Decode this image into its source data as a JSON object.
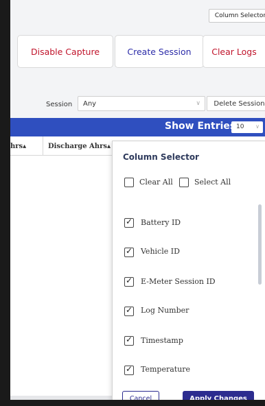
{
  "top": {
    "column_selector_label": "Column Selector"
  },
  "actions": {
    "disable_capture": "Disable Capture",
    "create_session": "Create Session",
    "clear_logs": "Clear Logs"
  },
  "session": {
    "label": "Session",
    "selected": "Any",
    "delete_label": "Delete Session"
  },
  "entries": {
    "label": "Show Entries:",
    "selected": "10"
  },
  "table": {
    "headers": [
      "hrs▴",
      "Discharge Ahrs▴"
    ]
  },
  "column_panel": {
    "title": "Column Selector",
    "clear_all": "Clear All",
    "select_all": "Select All",
    "columns": [
      {
        "label": "Battery ID",
        "checked": true
      },
      {
        "label": "Vehicle ID",
        "checked": true
      },
      {
        "label": "E-Meter Session ID",
        "checked": true
      },
      {
        "label": "Log Number",
        "checked": true
      },
      {
        "label": "Timestamp",
        "checked": true
      },
      {
        "label": "Temperature",
        "checked": true
      }
    ],
    "cancel_label": "Cancel",
    "apply_label": "Apply Changes"
  },
  "colors": {
    "accent_blue": "#2f4fbf",
    "danger_red": "#c0132a",
    "primary_button": "#2c2c8f"
  },
  "icons": {
    "session_dropdown": "chevron-down-icon",
    "entries_dropdown": "chevron-down-icon",
    "checkbox_checked": "checkmark-icon"
  }
}
